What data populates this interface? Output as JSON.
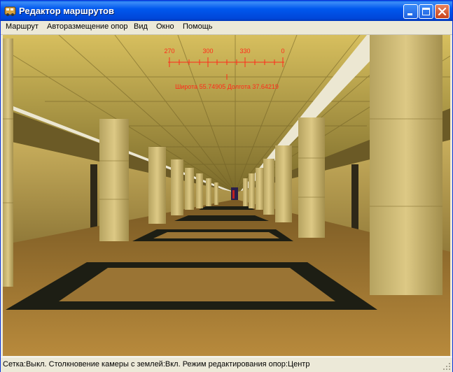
{
  "window": {
    "title": "Редактор маршрутов",
    "icon": "route-editor-app-icon",
    "controls": [
      "minimize-icon",
      "maximize-icon",
      "close-icon"
    ]
  },
  "menu": {
    "items": [
      {
        "label": "Маршрут"
      },
      {
        "label": "Авторазмещение опор"
      },
      {
        "label": "Вид"
      },
      {
        "label": "Окно"
      },
      {
        "label": "Помощь"
      }
    ]
  },
  "hud": {
    "compass_ticks": [
      "270",
      "300",
      "330",
      "0"
    ],
    "coordinates": "Широта 55.74905 Долгота 37.64219",
    "color": "#FF2A1A"
  },
  "status": {
    "text": "Сетка:Выкл. Столкновение камеры с землей:Вкл. Режим редактирования опор:Центр"
  },
  "colors": {
    "title_bar": "#0054E3",
    "window_face": "#ECE9D8",
    "hud_red": "#FF2A1A"
  }
}
